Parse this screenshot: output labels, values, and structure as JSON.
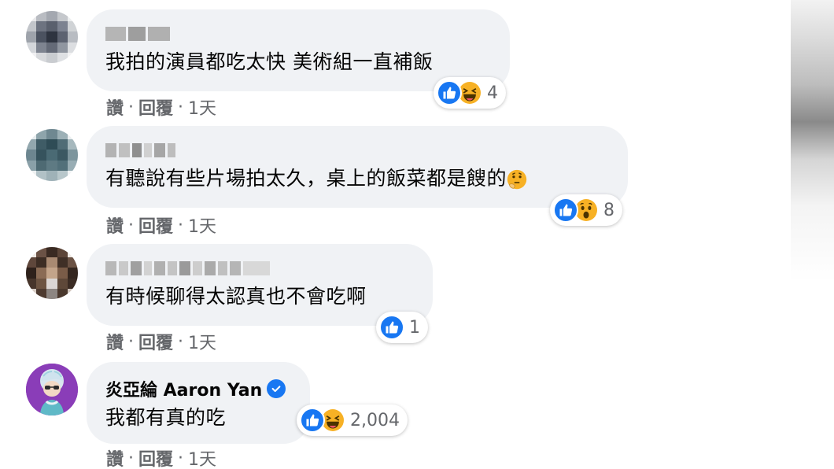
{
  "comments": [
    {
      "author": "",
      "text": "我拍的演員都吃太快 美術組一直補飯",
      "reaction_count": "4",
      "reactions": [
        "like-icon",
        "laughing-icon"
      ],
      "actions": {
        "like": "讚",
        "reply": "回覆",
        "time": "1天"
      }
    },
    {
      "author": "",
      "text": "有聽說有些片場拍太久，桌上的飯菜都是餿的",
      "reaction_count": "8",
      "reactions": [
        "like-icon",
        "wow-icon"
      ],
      "actions": {
        "like": "讚",
        "reply": "回覆",
        "time": "1天"
      }
    },
    {
      "author": "",
      "text": "有時候聊得太認真也不會吃啊",
      "reaction_count": "1",
      "reactions": [
        "like-icon"
      ],
      "actions": {
        "like": "讚",
        "reply": "回覆",
        "time": "1天"
      }
    },
    {
      "author": "炎亞綸 Aaron Yan",
      "verified": true,
      "text": "我都有真的吃",
      "reaction_count": "2,004",
      "reactions": [
        "like-icon",
        "laughing-icon"
      ],
      "actions": {
        "like": "讚",
        "reply": "回覆",
        "time": "1天"
      }
    }
  ],
  "separator": "·",
  "colors": {
    "bubble": "#f0f2f5",
    "like_blue": "#1877f2",
    "emoji_yellow": "#f7b125",
    "meta_gray": "#65676b"
  }
}
